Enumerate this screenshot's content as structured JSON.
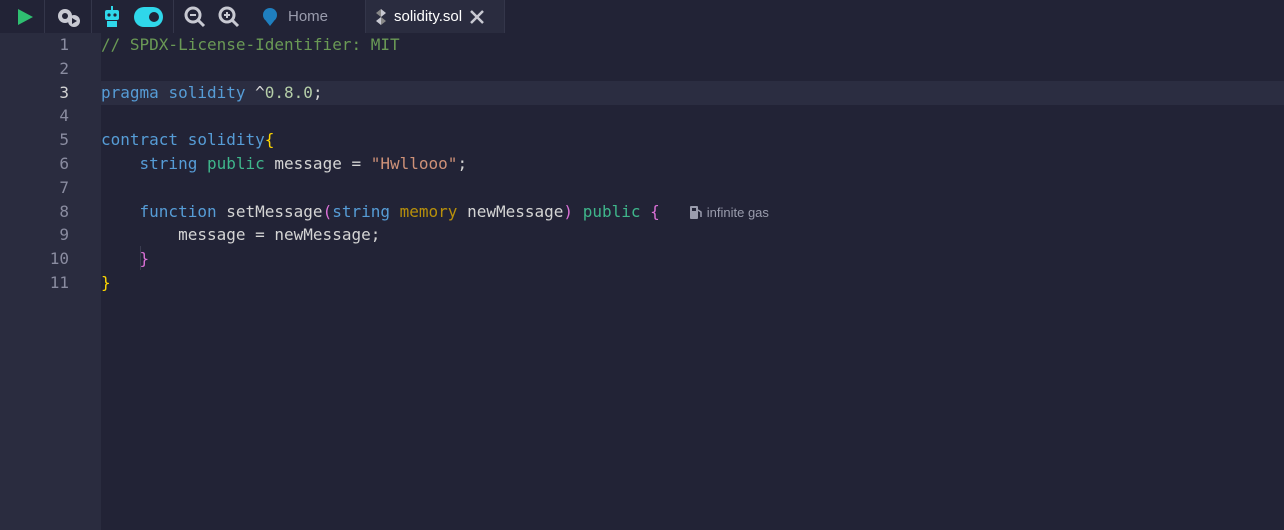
{
  "toolbar": {
    "run_icon": "play-icon",
    "settings_icon": "gear-play-icon",
    "robot_icon": "robot-icon",
    "zoom_out_icon": "zoom-out-icon",
    "zoom_in_icon": "zoom-in-icon"
  },
  "tabs": [
    {
      "label": "Home",
      "icon": "home-headset-icon",
      "active": false
    },
    {
      "label": "solidity.sol",
      "icon": "solidity-icon",
      "active": true
    }
  ],
  "editor": {
    "active_line": 3,
    "gas_hint": "infinite gas",
    "lines": [
      [
        {
          "t": "// SPDX-License-Identifier: MIT",
          "c": "comment"
        }
      ],
      [],
      [
        {
          "t": "pragma",
          "c": "kw"
        },
        {
          "t": " "
        },
        {
          "t": "solidity",
          "c": "kw"
        },
        {
          "t": " ^"
        },
        {
          "t": "0.8.0",
          "c": "num"
        },
        {
          "t": ";"
        }
      ],
      [],
      [
        {
          "t": "contract",
          "c": "kw"
        },
        {
          "t": " "
        },
        {
          "t": "solidity",
          "c": "kw"
        },
        {
          "t": "{",
          "c": "brace"
        }
      ],
      [
        {
          "t": "    "
        },
        {
          "t": "string",
          "c": "kw"
        },
        {
          "t": " "
        },
        {
          "t": "public",
          "c": "vis"
        },
        {
          "t": " message = "
        },
        {
          "t": "\"Hwllooo\"",
          "c": "str"
        },
        {
          "t": ";"
        }
      ],
      [],
      [
        {
          "t": "    "
        },
        {
          "t": "function",
          "c": "kw"
        },
        {
          "t": " setMessage"
        },
        {
          "t": "(",
          "c": "paren"
        },
        {
          "t": "string",
          "c": "kw"
        },
        {
          "t": " "
        },
        {
          "t": "memory",
          "c": "mem"
        },
        {
          "t": " newMessage"
        },
        {
          "t": ")",
          "c": "paren"
        },
        {
          "t": " "
        },
        {
          "t": "public",
          "c": "vis"
        },
        {
          "t": " "
        },
        {
          "t": "{",
          "c": "paren"
        }
      ],
      [
        {
          "t": "        message = newMessage;"
        }
      ],
      [
        {
          "t": "    "
        },
        {
          "t": "}",
          "c": "paren"
        }
      ],
      [
        {
          "t": "}",
          "c": "brace"
        }
      ]
    ]
  }
}
